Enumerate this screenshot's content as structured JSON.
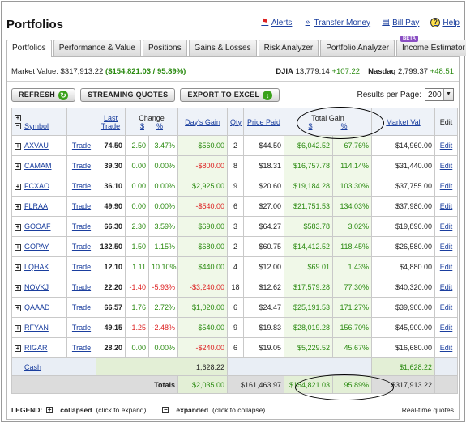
{
  "app": {
    "title": "Portfolios"
  },
  "top_links": [
    {
      "label": "Alerts",
      "icon": "flag-icon"
    },
    {
      "label": "Transfer Money",
      "icon": "transfer-icon"
    },
    {
      "label": "Bill Pay",
      "icon": "bill-icon"
    },
    {
      "label": "Help",
      "icon": "help-icon"
    }
  ],
  "tabs": [
    {
      "label": "Portfolios",
      "active": true
    },
    {
      "label": "Performance & Value"
    },
    {
      "label": "Positions"
    },
    {
      "label": "Gains & Losses"
    },
    {
      "label": "Risk Analyzer"
    },
    {
      "label": "Portfolio Analyzer"
    },
    {
      "label": "Income Estimator",
      "badge": "BETA"
    }
  ],
  "summary": {
    "market_value_label": "Market Value:",
    "market_value": "$317,913.22",
    "gain_text": "($154,821.03 / 95.89%)"
  },
  "indices": [
    {
      "name": "DJIA",
      "value": "13,779.14",
      "change": "+107.22"
    },
    {
      "name": "Nasdaq",
      "value": "2,799.37",
      "change": "+48.51"
    }
  ],
  "buttons": {
    "refresh": "REFRESH",
    "streaming": "STREAMING QUOTES",
    "export": "EXPORT TO EXCEL"
  },
  "results_per_page": {
    "label": "Results per Page:",
    "value": "200"
  },
  "columns": {
    "symbol": "Symbol",
    "last_trade": "Last Trade",
    "change": "Change",
    "change_dollar": "$",
    "change_pct": "%",
    "days_gain": "Day's Gain",
    "qty": "Qty",
    "price_paid": "Price Paid",
    "total_gain": "Total Gain",
    "total_gain_dollar": "$",
    "total_gain_pct": "%",
    "market_val": "Market Val",
    "edit": "Edit"
  },
  "rows": [
    {
      "symbol": "AXVAU",
      "trade": "Trade",
      "last": "74.50",
      "chg": "2.50",
      "chg_pct": "3.47%",
      "days_gain": "$560.00",
      "qty": "2",
      "price_paid": "$44.50",
      "tg": "$6,042.52",
      "tg_pct": "67.76%",
      "mval": "$14,960.00",
      "edit": "Edit"
    },
    {
      "symbol": "CAMAM",
      "trade": "Trade",
      "last": "39.30",
      "chg": "0.00",
      "chg_pct": "0.00%",
      "days_gain": "-$800.00",
      "qty": "8",
      "price_paid": "$18.31",
      "tg": "$16,757.78",
      "tg_pct": "114.14%",
      "mval": "$31,440.00",
      "edit": "Edit"
    },
    {
      "symbol": "FCXAO",
      "trade": "Trade",
      "last": "36.10",
      "chg": "0.00",
      "chg_pct": "0.00%",
      "days_gain": "$2,925.00",
      "qty": "9",
      "price_paid": "$20.60",
      "tg": "$19,184.28",
      "tg_pct": "103.30%",
      "mval": "$37,755.00",
      "edit": "Edit"
    },
    {
      "symbol": "FLRAA",
      "trade": "Trade",
      "last": "49.90",
      "chg": "0.00",
      "chg_pct": "0.00%",
      "days_gain": "-$540.00",
      "qty": "6",
      "price_paid": "$27.00",
      "tg": "$21,751.53",
      "tg_pct": "134.03%",
      "mval": "$37,980.00",
      "edit": "Edit"
    },
    {
      "symbol": "GOOAF",
      "trade": "Trade",
      "last": "66.30",
      "chg": "2.30",
      "chg_pct": "3.59%",
      "days_gain": "$690.00",
      "qty": "3",
      "price_paid": "$64.27",
      "tg": "$583.78",
      "tg_pct": "3.02%",
      "mval": "$19,890.00",
      "edit": "Edit"
    },
    {
      "symbol": "GOPAY",
      "trade": "Trade",
      "last": "132.50",
      "chg": "1.50",
      "chg_pct": "1.15%",
      "days_gain": "$680.00",
      "qty": "2",
      "price_paid": "$60.75",
      "tg": "$14,412.52",
      "tg_pct": "118.45%",
      "mval": "$26,580.00",
      "edit": "Edit"
    },
    {
      "symbol": "LQHAK",
      "trade": "Trade",
      "last": "12.10",
      "chg": "1.11",
      "chg_pct": "10.10%",
      "days_gain": "$440.00",
      "qty": "4",
      "price_paid": "$12.00",
      "tg": "$69.01",
      "tg_pct": "1.43%",
      "mval": "$4,880.00",
      "edit": "Edit"
    },
    {
      "symbol": "NOVKJ",
      "trade": "Trade",
      "last": "22.20",
      "chg": "-1.40",
      "chg_pct": "-5.93%",
      "days_gain": "-$3,240.00",
      "qty": "18",
      "price_paid": "$12.62",
      "tg": "$17,579.28",
      "tg_pct": "77.30%",
      "mval": "$40,320.00",
      "edit": "Edit"
    },
    {
      "symbol": "QAAAD",
      "trade": "Trade",
      "last": "66.57",
      "chg": "1.76",
      "chg_pct": "2.72%",
      "days_gain": "$1,020.00",
      "qty": "6",
      "price_paid": "$24.47",
      "tg": "$25,191.53",
      "tg_pct": "171.27%",
      "mval": "$39,900.00",
      "edit": "Edit"
    },
    {
      "symbol": "RFYAN",
      "trade": "Trade",
      "last": "49.15",
      "chg": "-1.25",
      "chg_pct": "-2.48%",
      "days_gain": "$540.00",
      "qty": "9",
      "price_paid": "$19.83",
      "tg": "$28,019.28",
      "tg_pct": "156.70%",
      "mval": "$45,900.00",
      "edit": "Edit"
    },
    {
      "symbol": "RIGAR",
      "trade": "Trade",
      "last": "28.20",
      "chg": "0.00",
      "chg_pct": "0.00%",
      "days_gain": "-$240.00",
      "qty": "6",
      "price_paid": "$19.05",
      "tg": "$5,229.52",
      "tg_pct": "45.67%",
      "mval": "$16,680.00",
      "edit": "Edit"
    }
  ],
  "cash": {
    "label": "Cash",
    "value": "1,628.22",
    "mval": "$1,628.22"
  },
  "totals": {
    "label": "Totals",
    "days_gain": "$2,035.00",
    "price_paid": "$161,463.97",
    "tg": "$154,821.03",
    "tg_pct": "95.89%",
    "mval": "$317,913.22"
  },
  "legend": {
    "title": "LEGEND:",
    "collapsed": "collapsed",
    "collapsed_hint": "(click to expand)",
    "expanded": "expanded",
    "expanded_hint": "(click to collapse)"
  },
  "realtime": "Real-time quotes",
  "colors": {
    "gain": "#2a8a10",
    "loss": "#dd2222",
    "link": "#1a3e9e"
  }
}
